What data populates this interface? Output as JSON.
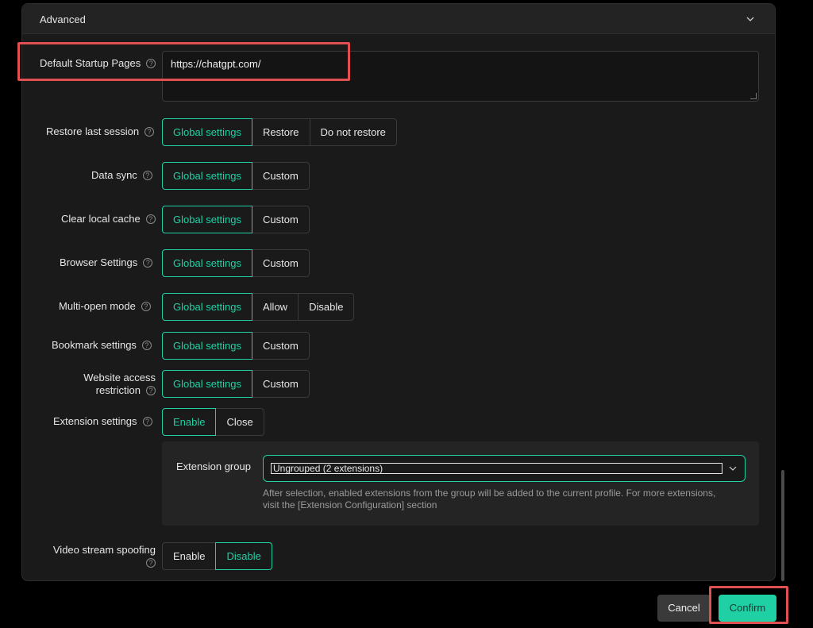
{
  "panel": {
    "title": "Advanced"
  },
  "startup": {
    "label": "Default Startup Pages",
    "value": "https://chatgpt.com/"
  },
  "help_glyph": "?",
  "rows": {
    "restore_session": {
      "label": "Restore last session",
      "options": [
        "Global settings",
        "Restore",
        "Do not restore"
      ]
    },
    "data_sync": {
      "label": "Data sync",
      "options": [
        "Global settings",
        "Custom"
      ]
    },
    "clear_cache": {
      "label": "Clear local cache",
      "options": [
        "Global settings",
        "Custom"
      ]
    },
    "browser_settings": {
      "label": "Browser Settings",
      "options": [
        "Global settings",
        "Custom"
      ]
    },
    "multi_open": {
      "label": "Multi-open mode",
      "options": [
        "Global settings",
        "Allow",
        "Disable"
      ]
    },
    "bookmark": {
      "label": "Bookmark settings",
      "options": [
        "Global settings",
        "Custom"
      ]
    },
    "website_access": {
      "label_line1": "Website access",
      "label_line2": "restriction",
      "options": [
        "Global settings",
        "Custom"
      ]
    },
    "extension": {
      "label": "Extension settings",
      "options": [
        "Enable",
        "Close"
      ]
    },
    "video_spoofing": {
      "label": "Video stream spoofing",
      "options": [
        "Enable",
        "Disable"
      ]
    }
  },
  "extension_group": {
    "label": "Extension group",
    "selected": "Ungrouped (2 extensions)",
    "note": "After selection, enabled extensions from the group will be added to the current profile. For more extensions, visit the [Extension Configuration] section"
  },
  "footer": {
    "cancel_label": "Cancel",
    "confirm_label": "Confirm"
  },
  "colors": {
    "accent": "#1fd0a5",
    "highlight": "#e05050",
    "background": "#1a1a1a"
  }
}
